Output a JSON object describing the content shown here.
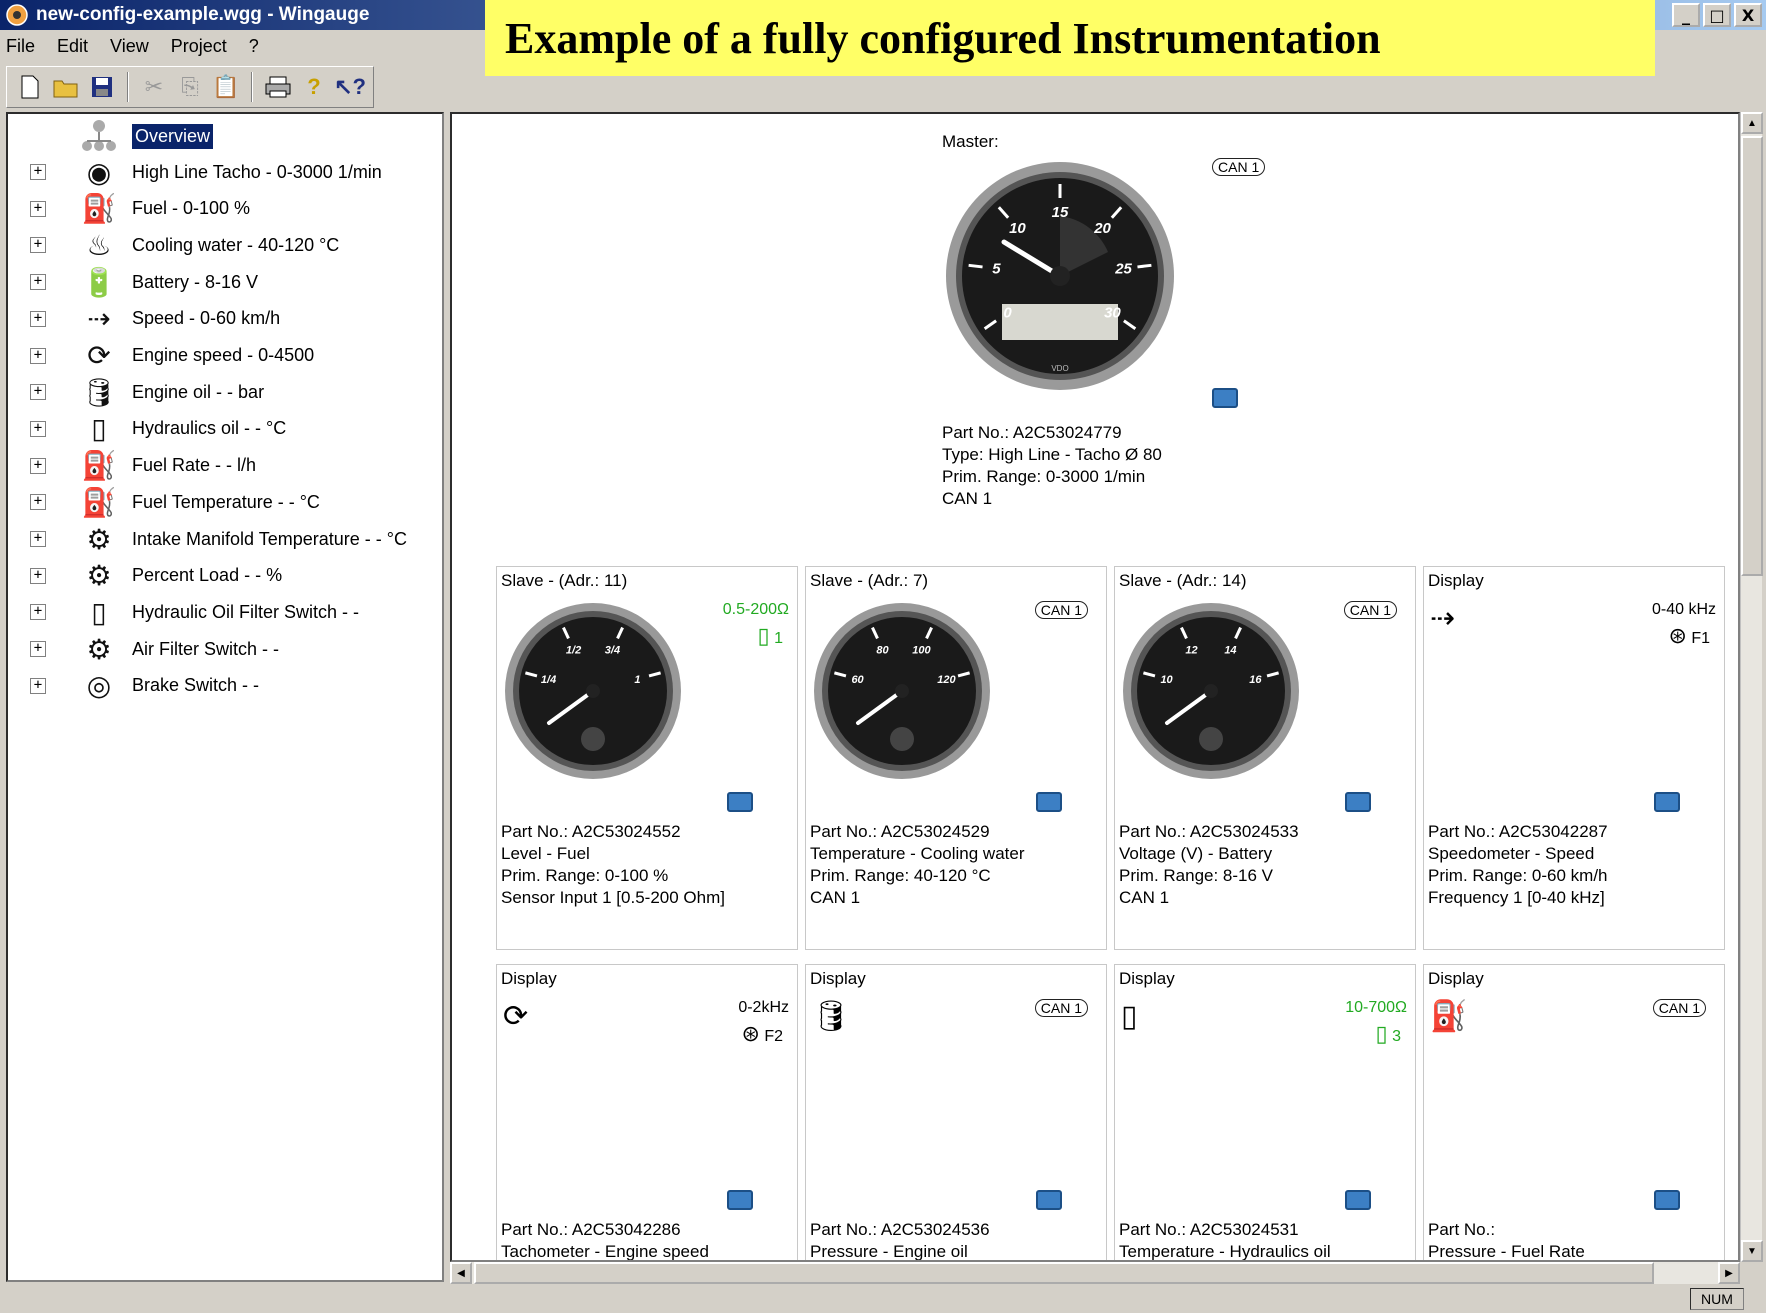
{
  "window": {
    "title": "new-config-example.wgg - Wingauge",
    "controls": [
      "_",
      "□",
      "X"
    ]
  },
  "banner": "Example of a fully configured Instrumentation",
  "menu": [
    "File",
    "Edit",
    "View",
    "Project",
    "?"
  ],
  "toolbar": {
    "icons": [
      "new-icon",
      "open-icon",
      "save-icon",
      "cut-icon",
      "copy-icon",
      "paste-icon",
      "print-icon",
      "help-icon",
      "context-help-icon"
    ]
  },
  "tree": {
    "root": "Overview",
    "items": [
      {
        "label": "High Line Tacho - 0-3000 1/min",
        "icon": "tacho-gauge-icon"
      },
      {
        "label": "Fuel - 0-100 %",
        "icon": "fuel-pump-icon"
      },
      {
        "label": "Cooling water - 40-120 °C",
        "icon": "coolant-icon"
      },
      {
        "label": "Battery - 8-16 V",
        "icon": "battery-icon"
      },
      {
        "label": "Speed - 0-60 km/h",
        "icon": "speed-icon"
      },
      {
        "label": "Engine speed - 0-4500",
        "icon": "engine-speed-icon"
      },
      {
        "label": "Engine oil - - bar",
        "icon": "oil-can-icon"
      },
      {
        "label": "Hydraulics oil - - °C",
        "icon": "hydraulic-oil-icon"
      },
      {
        "label": "Fuel Rate - - l/h",
        "icon": "fuel-rate-icon"
      },
      {
        "label": "Fuel Temperature - - °C",
        "icon": "fuel-temperature-icon"
      },
      {
        "label": "Intake Manifold Temperature - - °C",
        "icon": "intake-manifold-icon"
      },
      {
        "label": "Percent Load - - %",
        "icon": "percent-load-icon"
      },
      {
        "label": "Hydraulic Oil Filter Switch - -",
        "icon": "oil-filter-icon"
      },
      {
        "label": "Air Filter Switch - -",
        "icon": "air-filter-icon"
      },
      {
        "label": "Brake Switch - -",
        "icon": "brake-icon"
      }
    ]
  },
  "master": {
    "label": "Master:",
    "can": "CAN 1",
    "gauge_ticks": [
      "0",
      "5",
      "10",
      "15",
      "20",
      "25",
      "30"
    ],
    "info": [
      "Part No.: A2C53024779",
      "Type: High Line - Tacho Ø 80",
      "Prim. Range: 0-3000 1/min",
      "CAN 1"
    ]
  },
  "cards": [
    {
      "title": "Slave - (Adr.: 11)",
      "range": "0.5-200Ω",
      "sensor": "1",
      "gauge_ticks": [
        "1/4",
        "1/2",
        "3/4",
        "1"
      ],
      "info": [
        "Part No.: A2C53024552",
        "Level - Fuel",
        "Prim. Range: 0-100 %",
        "Sensor Input 1 [0.5-200 Ohm]"
      ]
    },
    {
      "title": "Slave - (Adr.: 7)",
      "can": "CAN 1",
      "gauge_ticks": [
        "60",
        "80",
        "100",
        "120"
      ],
      "info": [
        "Part No.: A2C53024529",
        "Temperature - Cooling water",
        "Prim. Range: 40-120 °C",
        "CAN 1"
      ]
    },
    {
      "title": "Slave - (Adr.: 14)",
      "can": "CAN 1",
      "gauge_ticks": [
        "10",
        "12",
        "14",
        "16"
      ],
      "info": [
        "Part No.: A2C53024533",
        "Voltage (V) - Battery",
        "Prim. Range: 8-16 V",
        "CAN 1"
      ]
    },
    {
      "title": "Display",
      "range": "0-40 kHz",
      "sensor": "F1",
      "info": [
        "Part No.: A2C53042287",
        "Speedometer - Speed",
        "Prim. Range: 0-60 km/h",
        "Frequency 1 [0-40 kHz]"
      ]
    },
    {
      "title": "Display",
      "range": "0-2kHz",
      "sensor": "F2",
      "info": [
        "Part No.: A2C53042286",
        "Tachometer - Engine speed"
      ]
    },
    {
      "title": "Display",
      "can": "CAN 1",
      "info": [
        "Part No.: A2C53024536",
        "Pressure - Engine oil"
      ]
    },
    {
      "title": "Display",
      "range": "10-700Ω",
      "sensor": "3",
      "info": [
        "Part No.: A2C53024531",
        "Temperature - Hydraulics oil"
      ]
    },
    {
      "title": "Display",
      "can": "CAN 1",
      "info": [
        "Part No.:",
        "Pressure - Fuel Rate"
      ]
    }
  ],
  "status": {
    "num": "NUM"
  },
  "colors": {
    "banner": "#ffff66",
    "selection": "#0a246a",
    "green_range": "#22aa22"
  }
}
